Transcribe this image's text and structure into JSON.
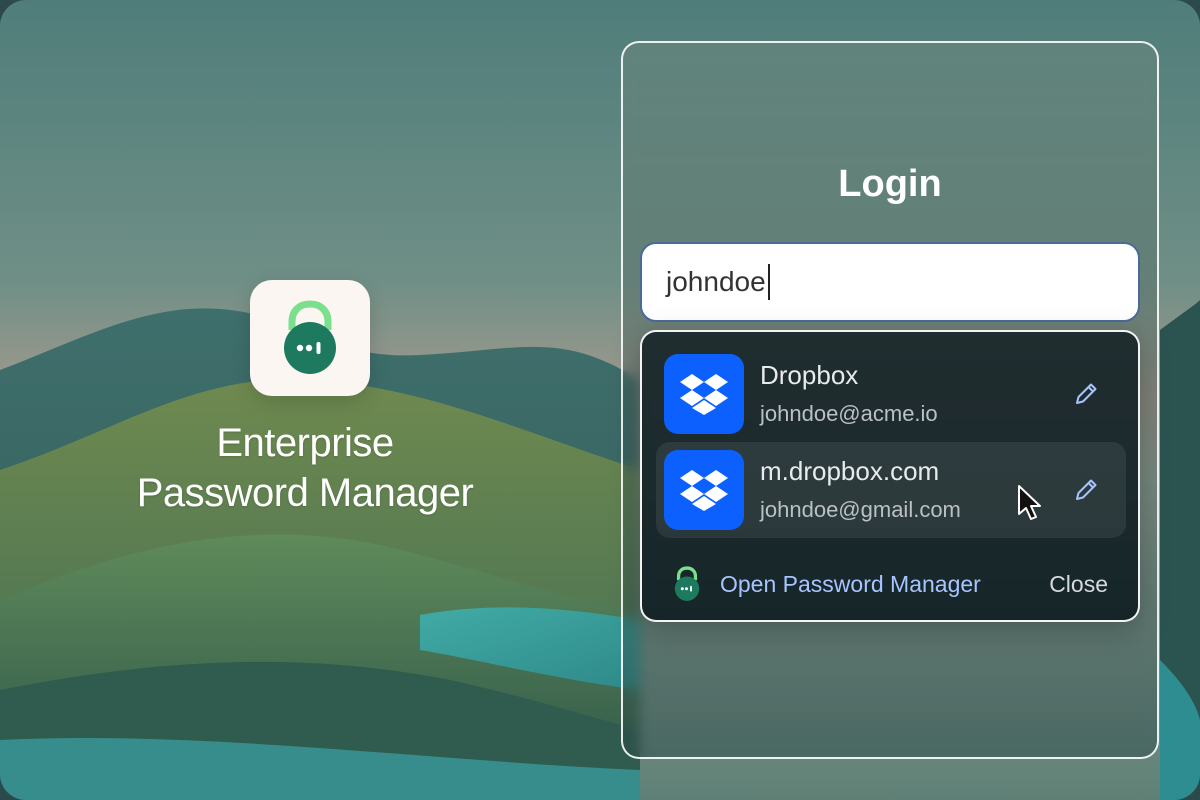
{
  "brand": {
    "name_line1": "Enterprise",
    "name_line2": "Password Manager",
    "icon": "lock-icon"
  },
  "login": {
    "title": "Login",
    "search_value": "johndoe"
  },
  "suggestions": [
    {
      "site": "Dropbox",
      "account": "johndoe@acme.io",
      "icon": "dropbox-icon"
    },
    {
      "site": "m.dropbox.com",
      "account": "johndoe@gmail.com",
      "icon": "dropbox-icon"
    }
  ],
  "footer": {
    "open_label": "Open Password Manager",
    "close_label": "Close"
  },
  "colors": {
    "brand_green": "#1e7a5e",
    "lock_shackle": "#7be08e",
    "dropbox_blue": "#0c61fe",
    "link_blue": "#a8c4ff"
  }
}
